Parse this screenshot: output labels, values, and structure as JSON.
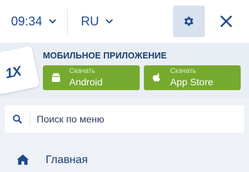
{
  "header": {
    "time": "09:34",
    "language": "RU",
    "icons": {
      "settings": "gear-icon",
      "close": "close-icon",
      "chevron": "chevron-down-icon"
    },
    "colors": {
      "accent": "#1d4b8c",
      "settings_bg": "#d8e2ee"
    }
  },
  "app_banner": {
    "logo_text": "1X",
    "title": "МОБИЛЬНОЕ ПРИЛОЖЕНИЕ",
    "buttons": [
      {
        "sub": "Скачать",
        "label": "Android",
        "icon": "android-icon"
      },
      {
        "sub": "Скачать",
        "label": "App Store",
        "icon": "apple-icon"
      }
    ],
    "colors": {
      "button_bg": "#76aa2e"
    }
  },
  "search": {
    "placeholder": "Поиск по меню",
    "value": "",
    "icon": "search-icon"
  },
  "menu": {
    "items": [
      {
        "label": "Главная",
        "icon": "home-icon"
      }
    ]
  }
}
